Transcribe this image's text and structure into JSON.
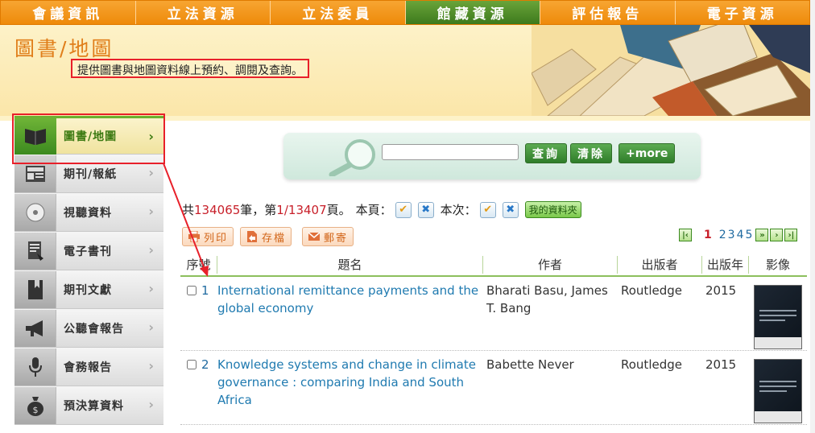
{
  "topnav": {
    "items": [
      {
        "label": "會議資訊"
      },
      {
        "label": "立法資源"
      },
      {
        "label": "立法委員"
      },
      {
        "label": "館藏資源"
      },
      {
        "label": "評估報告"
      },
      {
        "label": "電子資源"
      }
    ],
    "active_index": 3
  },
  "banner": {
    "title": "圖書/地圖",
    "description": "提供圖書與地圖資料線上預約、調閱及查詢。"
  },
  "sidebar": {
    "items": [
      {
        "label": "圖書/地圖",
        "icon": "book-icon"
      },
      {
        "label": "期刊/報紙",
        "icon": "newspaper-icon"
      },
      {
        "label": "視聽資料",
        "icon": "disc-icon"
      },
      {
        "label": "電子書刊",
        "icon": "ebook-icon"
      },
      {
        "label": "期刊文獻",
        "icon": "bookmark-icon"
      },
      {
        "label": "公聽會報告",
        "icon": "megaphone-icon"
      },
      {
        "label": "會務報告",
        "icon": "microphone-icon"
      },
      {
        "label": "預決算資料",
        "icon": "money-bag-icon"
      }
    ],
    "chevron": "›"
  },
  "search": {
    "input_value": "",
    "placeholder": "",
    "query_label": "查詢",
    "clear_label": "清除",
    "more_label": "+more"
  },
  "summary": {
    "prefix": "共",
    "total": "134065",
    "unit_records": "筆，第",
    "page_info": "1/13407",
    "unit_pages": "頁。",
    "this_page_label": "本頁：",
    "this_time_label": "本次：",
    "my_folder_label": "我的資料夾",
    "check_glyph": "✔",
    "cross_glyph": "✖"
  },
  "actions": {
    "print_label": "列印",
    "save_label": "存檔",
    "email_label": "郵寄"
  },
  "pager": {
    "current": "1",
    "pages": [
      "2",
      "3",
      "4",
      "5"
    ],
    "first_glyph": "|‹",
    "next_glyph": "»",
    "nextpage_glyph": "›",
    "last_glyph": "›|"
  },
  "table": {
    "headers": {
      "no": "序號",
      "title": "題名",
      "author": "作者",
      "publisher": "出版者",
      "year": "出版年",
      "image": "影像"
    },
    "rows": [
      {
        "no": "1",
        "title": "International remittance payments and the global economy",
        "author": "Bharati Basu, James T. Bang",
        "publisher": "Routledge",
        "year": "2015"
      },
      {
        "no": "2",
        "title": "Knowledge systems and change in climate governance : comparing India and South Africa",
        "author": "Babette Never",
        "publisher": "Routledge",
        "year": "2015"
      }
    ]
  },
  "colors": {
    "nav_orange": "#f39a19",
    "nav_active_green": "#3d7a1c",
    "highlight_red": "#e8202a",
    "link_blue": "#1f7ab0"
  }
}
